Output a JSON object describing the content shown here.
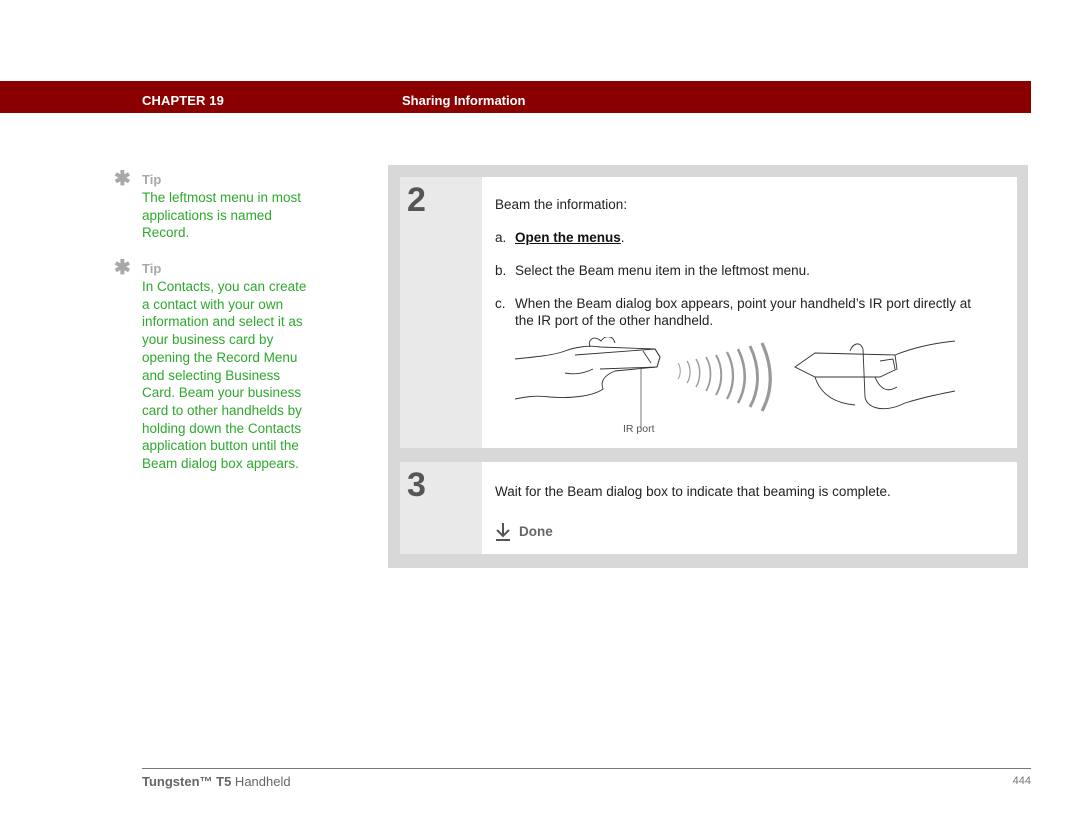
{
  "header": {
    "chapter": "CHAPTER 19",
    "title": "Sharing Information",
    "bar_color": "#8a0000"
  },
  "sidebar": {
    "tips": [
      {
        "icon": "asterisk-icon",
        "label": "Tip",
        "text": "The leftmost menu in most applications is named Record."
      },
      {
        "icon": "asterisk-icon",
        "label": "Tip",
        "text": "In Contacts, you can create a contact with your own information and select it as your business card by opening the Record Menu and selecting Business Card. Beam your business card to other handhelds by holding down the Contacts application button until the Beam dialog box appears."
      }
    ],
    "tip_color": "#2ea82e"
  },
  "steps": [
    {
      "number": "2",
      "intro": "Beam the information:",
      "items": [
        {
          "letter": "a.",
          "link": "Open the menus",
          "suffix": "."
        },
        {
          "letter": "b.",
          "text": "Select the Beam menu item in the leftmost menu."
        },
        {
          "letter": "c.",
          "text_line1": "When the Beam dialog box appears, point your handheld’s IR port directly at",
          "text_line2": "the IR port of the other handheld."
        }
      ],
      "illustration": {
        "description": "two-handhelds-beaming-illustration",
        "callout": "IR port"
      }
    },
    {
      "number": "3",
      "text": "Wait for the Beam dialog box to indicate that beaming is complete.",
      "done_label": "Done"
    }
  ],
  "footer": {
    "product_bold": "Tungsten™ T5",
    "product_rest": " Handheld",
    "page": "444"
  }
}
